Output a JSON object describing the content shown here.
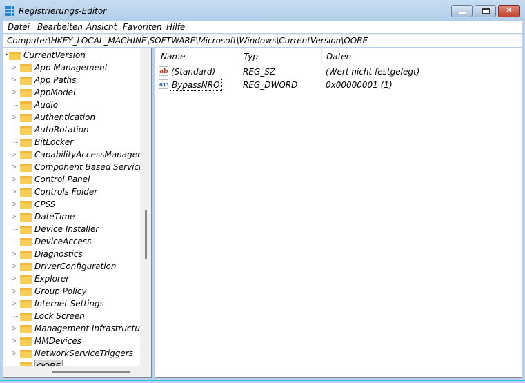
{
  "window": {
    "title": "Registrierungs-Editor",
    "minimize": "—",
    "maximize": "□",
    "close": "✕"
  },
  "menu": [
    "Datei",
    "Bearbeiten",
    "Ansicht",
    "Favoriten",
    "Hilfe"
  ],
  "address": "Computer\\HKEY_LOCAL_MACHINE\\SOFTWARE\\Microsoft\\Windows\\CurrentVersion\\OOBE",
  "tree": {
    "root": "CurrentVersion",
    "items": [
      {
        "label": "App Management",
        "expandable": true
      },
      {
        "label": "App Paths",
        "expandable": true
      },
      {
        "label": "AppModel",
        "expandable": true
      },
      {
        "label": "Audio",
        "expandable": false
      },
      {
        "label": "Authentication",
        "expandable": true
      },
      {
        "label": "AutoRotation",
        "expandable": false
      },
      {
        "label": "BitLocker",
        "expandable": false
      },
      {
        "label": "CapabilityAccessManager",
        "expandable": true
      },
      {
        "label": "Component Based Servicing",
        "expandable": true
      },
      {
        "label": "Control Panel",
        "expandable": true
      },
      {
        "label": "Controls Folder",
        "expandable": true
      },
      {
        "label": "CPSS",
        "expandable": true
      },
      {
        "label": "DateTime",
        "expandable": true
      },
      {
        "label": "Device Installer",
        "expandable": false
      },
      {
        "label": "DeviceAccess",
        "expandable": false
      },
      {
        "label": "Diagnostics",
        "expandable": true
      },
      {
        "label": "DriverConfiguration",
        "expandable": true
      },
      {
        "label": "Explorer",
        "expandable": true
      },
      {
        "label": "Group Policy",
        "expandable": true
      },
      {
        "label": "Internet Settings",
        "expandable": true
      },
      {
        "label": "Lock Screen",
        "expandable": false
      },
      {
        "label": "Management Infrastructure",
        "expandable": true
      },
      {
        "label": "MMDevices",
        "expandable": true
      },
      {
        "label": "NetworkServiceTriggers",
        "expandable": true
      },
      {
        "label": "OOBE",
        "expandable": false,
        "selected": true
      }
    ]
  },
  "list": {
    "columns": [
      "Name",
      "Typ",
      "Daten"
    ],
    "rows": [
      {
        "icon": "ab",
        "name": "(Standard)",
        "type": "REG_SZ",
        "data": "(Wert nicht festgelegt)"
      },
      {
        "icon": "011",
        "name": "BypassNRO",
        "type": "REG_DWORD",
        "data": "0x00000001 (1)"
      }
    ]
  }
}
